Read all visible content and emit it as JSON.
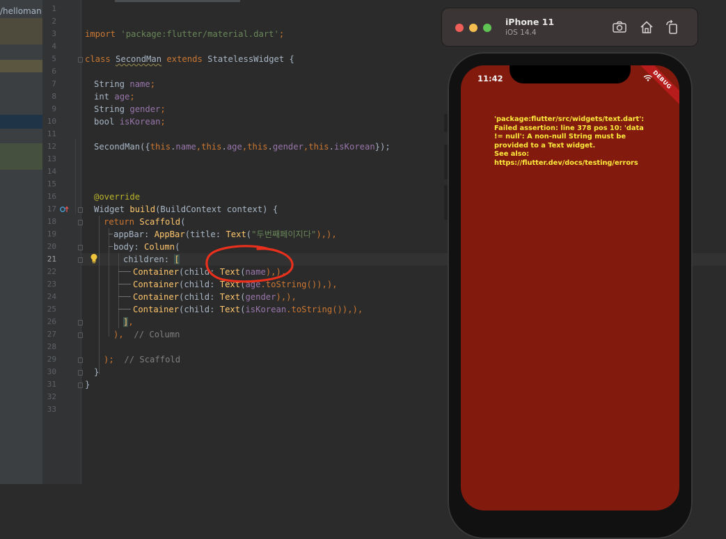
{
  "project": {
    "name": "/helloman"
  },
  "editor": {
    "line_numbers": [
      "1",
      "2",
      "3",
      "4",
      "5",
      "6",
      "7",
      "8",
      "9",
      "10",
      "11",
      "12",
      "13",
      "14",
      "15",
      "16",
      "17",
      "18",
      "19",
      "20",
      "21",
      "22",
      "23",
      "24",
      "25",
      "26",
      "27",
      "28",
      "29",
      "30",
      "31",
      "32",
      "33"
    ],
    "current_line": 21,
    "code": {
      "l3": {
        "kw": "import",
        "str": "'package:flutter/material.dart'",
        "end": ";"
      },
      "l5": {
        "kw1": "class",
        "cls": "SecondMan",
        "kw2": "extends",
        "rest": "StatelessWidget {"
      },
      "l7": {
        "type": "String",
        "fld": "name",
        "end": ";"
      },
      "l8": {
        "type": "int",
        "fld": "age",
        "end": ";"
      },
      "l9": {
        "type": "String",
        "fld": "gender",
        "end": ";"
      },
      "l10": {
        "type": "bool",
        "fld": "isKorean",
        "end": ";"
      },
      "l12": {
        "a": "SecondMan({",
        "t1": "this",
        "f1": "name",
        "c1": ",",
        "t2": "this",
        "f2": "age",
        "c2": ",",
        "t3": "this",
        "f3": "gender",
        "c3": ",",
        "t4": "this",
        "f4": "isKorean",
        "end": "});"
      },
      "l16": {
        "ann": "@override"
      },
      "l17": {
        "type": "Widget",
        "fn": "build",
        "rest": "(BuildContext context) {"
      },
      "l18": {
        "kw": "return",
        "fn": "Scaffold",
        "rest": "("
      },
      "l19": {
        "a": "appBar: ",
        "fn1": "AppBar",
        "b": "(title: ",
        "fn2": "Text",
        "c": "(",
        "str": "\"두번째페이지다\"",
        "end": "),),"
      },
      "l20": {
        "a": "body: ",
        "fn": "Column",
        "rest": "("
      },
      "l21": {
        "a": "children: ",
        "bracket": "["
      },
      "l22": {
        "fn1": "Container",
        "a": "(child: ",
        "fn2": "Text",
        "b": "(",
        "fld": "name",
        "end": "),),"
      },
      "l23": {
        "fn1": "Container",
        "a": "(child: ",
        "fn2": "Text",
        "b": "(",
        "fld": "age",
        "c": ".toString()),),"
      },
      "l24": {
        "fn1": "Container",
        "a": "(child: ",
        "fn2": "Text",
        "b": "(",
        "fld": "gender",
        "end": "),),"
      },
      "l25": {
        "fn1": "Container",
        "a": "(child: ",
        "fn2": "Text",
        "b": "(",
        "fld": "isKorean",
        "c": ".toString()),),"
      },
      "l26": {
        "bracket": "]",
        "end": ","
      },
      "l27": {
        "a": "),",
        "cmt": "// Column"
      },
      "l29": {
        "a": ");",
        "cmt": "// Scaffold"
      },
      "l30": {
        "a": "}"
      },
      "l31": {
        "a": "}"
      }
    }
  },
  "simulator": {
    "device_name": "iPhone 11",
    "os_version": "iOS 14.4",
    "toolbar_icons": [
      "camera-icon",
      "home-icon",
      "rotate-icon"
    ],
    "status_time": "11:42",
    "debug_banner": "DEBUG",
    "error_message": "'package:flutter/src/widgets/text.dart': Failed assertion: line 378 pos 10: 'data != null': A non-null String must be provided to a Text widget.\nSee also: https://flutter.dev/docs/testing/errors",
    "colors": {
      "error_bg": "#821a0e",
      "error_text": "#ffeb3b"
    }
  }
}
